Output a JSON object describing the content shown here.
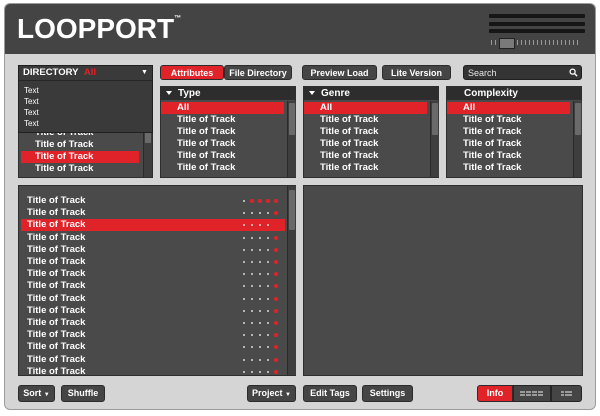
{
  "app": {
    "logo": "LOOPPORT",
    "trademark": "™"
  },
  "directory": {
    "label": "DIRECTORY",
    "value": "All",
    "options": [
      "Text",
      "Text",
      "Text",
      "Text"
    ]
  },
  "toolbar": {
    "attributes_label": "Attributes",
    "file_directory_label": "File Directory",
    "preview_load_label": "Preview Load",
    "lite_version_label": "Lite Version"
  },
  "search": {
    "placeholder": "Search"
  },
  "directory_list": {
    "items": [
      "Title of Track",
      "Title of Track",
      "Title of Track",
      "Title of Track"
    ],
    "selected_index": 2
  },
  "filters": [
    {
      "title": "Type",
      "all_label": "All",
      "items": [
        "Title of Track",
        "Title of Track",
        "Title of Track",
        "Title of Track",
        "Title of Track"
      ]
    },
    {
      "title": "Genre",
      "all_label": "All",
      "items": [
        "Title of Track",
        "Title of Track",
        "Title of Track",
        "Title of Track",
        "Title of Track"
      ]
    },
    {
      "title": "Complexity",
      "all_label": "All",
      "items": [
        "Title of Track",
        "Title of Track",
        "Title of Track",
        "Title of Track",
        "Title of Track"
      ]
    }
  ],
  "tracks": {
    "selected_index": 2,
    "items": [
      {
        "title": "Title of Track",
        "rating": 4
      },
      {
        "title": "Title of Track",
        "rating": 1
      },
      {
        "title": "Title of Track",
        "rating": 1
      },
      {
        "title": "Title of Track",
        "rating": 1
      },
      {
        "title": "Title of Track",
        "rating": 1
      },
      {
        "title": "Title of Track",
        "rating": 1
      },
      {
        "title": "Title of Track",
        "rating": 1
      },
      {
        "title": "Title of Track",
        "rating": 1
      },
      {
        "title": "Title of Track",
        "rating": 1
      },
      {
        "title": "Title of Track",
        "rating": 1
      },
      {
        "title": "Title of Track",
        "rating": 1
      },
      {
        "title": "Title of Track",
        "rating": 1
      },
      {
        "title": "Title of Track",
        "rating": 1
      },
      {
        "title": "Title of Track",
        "rating": 1
      },
      {
        "title": "Title of Track",
        "rating": 1
      }
    ]
  },
  "bottom": {
    "sort_label": "Sort",
    "shuffle_label": "Shuffle",
    "project_label": "Project",
    "edit_tags_label": "Edit Tags",
    "settings_label": "Settings",
    "info_label": "Info"
  },
  "colors": {
    "accent": "#e02229",
    "panel": "#4a4a4a",
    "header": "#444444",
    "background": "#d5d5d5"
  }
}
